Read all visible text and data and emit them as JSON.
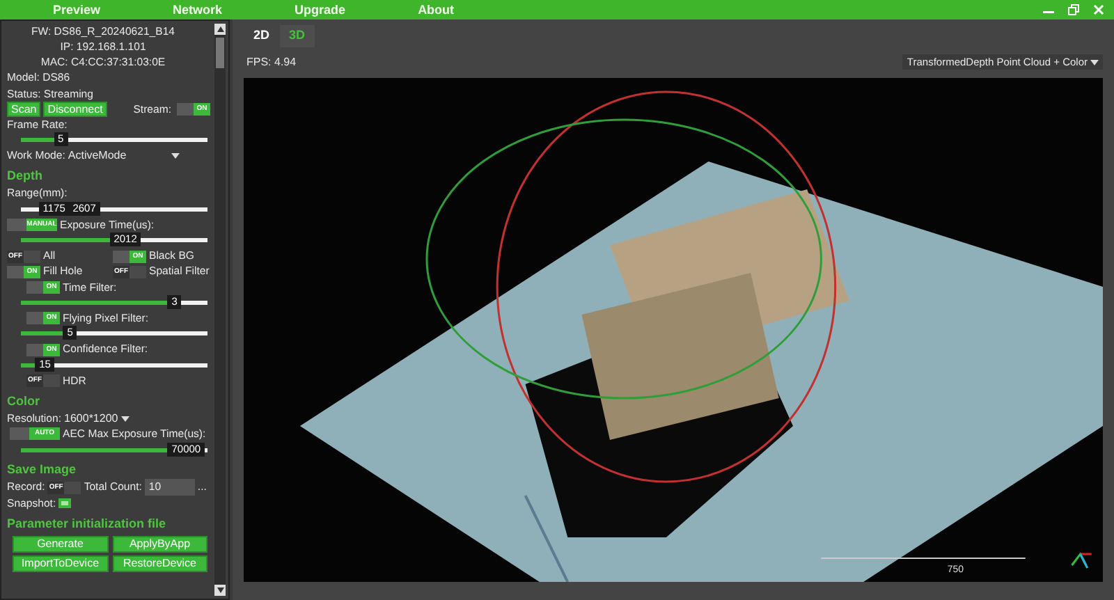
{
  "menu": [
    {
      "label": "Preview",
      "selected": false
    },
    {
      "label": "Network",
      "selected": false
    },
    {
      "label": "Upgrade",
      "selected": false
    },
    {
      "label": "About",
      "selected": false
    }
  ],
  "panel": [
    {
      "kind": "info",
      "text": "FW: DS86_R_20240621_B14"
    },
    {
      "kind": "info",
      "text": "IP: 192.168.1.101"
    },
    {
      "kind": "info",
      "text": "MAC: C4:CC:37:31:03:0E"
    },
    {
      "kind": "text",
      "text": "Model: DS86"
    },
    {
      "kind": "text",
      "text": "Status: Streaming"
    },
    {
      "kind": "connect",
      "buttons": [
        "Scan",
        "Disconnect"
      ],
      "label": "Stream:",
      "switch": {
        "text": "ON",
        "on": true
      }
    },
    {
      "kind": "text",
      "text": "Frame Rate:"
    },
    {
      "kind": "slider",
      "level": 0.25,
      "reading": "5"
    },
    {
      "kind": "select",
      "label": "Work Mode:",
      "value": "ActiveMode"
    },
    {
      "kind": "heading",
      "text": "Depth"
    },
    {
      "kind": "text",
      "text": "Range(mm):"
    },
    {
      "kind": "range",
      "handles": [
        {
          "level": 0.17,
          "reading": "1175"
        },
        {
          "level": 0.33,
          "reading": "2607"
        }
      ]
    },
    {
      "kind": "toggle",
      "label": "Exposure Time(us):",
      "switch": {
        "text": "MANUAL",
        "on": true
      }
    },
    {
      "kind": "slider",
      "level": 0.55,
      "reading": "2012"
    },
    {
      "kind": "pair",
      "items": [
        {
          "label": "All",
          "switch": {
            "text": "OFF",
            "on": false
          }
        },
        {
          "label": "Black BG",
          "switch": {
            "text": "ON",
            "on": true
          }
        }
      ]
    },
    {
      "kind": "pair",
      "items": [
        {
          "label": "Fill Hole",
          "switch": {
            "text": "ON",
            "on": true
          }
        },
        {
          "label": "Spatial Filter",
          "switch": {
            "text": "OFF",
            "on": false
          }
        }
      ]
    },
    {
      "kind": "toggle",
      "label": "Time Filter:",
      "switch": {
        "text": "ON",
        "on": true
      }
    },
    {
      "kind": "slider",
      "level": 0.86,
      "reading": "3"
    },
    {
      "kind": "toggle",
      "label": "Flying Pixel Filter:",
      "switch": {
        "text": "ON",
        "on": true
      }
    },
    {
      "kind": "slider",
      "level": 0.3,
      "reading": "5"
    },
    {
      "kind": "toggle",
      "label": "Confidence Filter:",
      "switch": {
        "text": "ON",
        "on": true
      }
    },
    {
      "kind": "slider",
      "level": 0.15,
      "reading": "15"
    },
    {
      "kind": "toggle",
      "label": "HDR",
      "switch": {
        "text": "OFF",
        "on": false
      }
    },
    {
      "kind": "heading",
      "text": "Color"
    },
    {
      "kind": "select",
      "label": "Resolution:",
      "value": "1600*1200"
    },
    {
      "kind": "toggle",
      "label": "AEC Max Exposure Time(us):",
      "switch": {
        "text": "AUTO",
        "on": true
      }
    },
    {
      "kind": "slider",
      "level": 0.86,
      "reading": "70000"
    },
    {
      "kind": "heading",
      "text": "Save Image"
    },
    {
      "kind": "record",
      "label": "Record:",
      "switch": {
        "text": "OFF",
        "on": false
      },
      "count_label": "Total Count:",
      "count": "10",
      "more": "..."
    },
    {
      "kind": "snapshot",
      "label": "Snapshot:"
    },
    {
      "kind": "heading",
      "text": "Parameter initialization file"
    },
    {
      "kind": "buttons",
      "buttons": [
        "Generate",
        "ApplyByApp",
        "ImportToDevice",
        "RestoreDevice"
      ]
    }
  ],
  "view_tabs": [
    {
      "label": "2D",
      "selected": false
    },
    {
      "label": "3D",
      "selected": true
    }
  ],
  "fps": "FPS: 4.94",
  "view_mode": "TransformedDepth Point Cloud + Color",
  "scale": "750"
}
